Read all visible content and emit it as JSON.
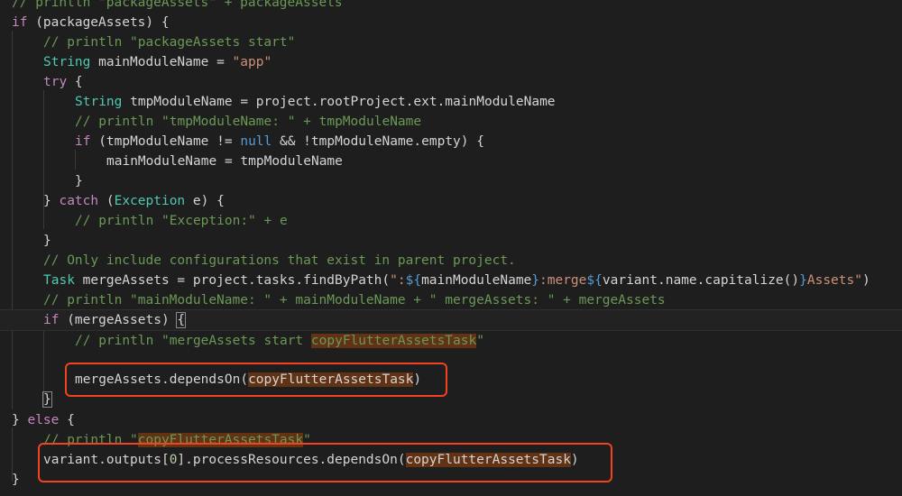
{
  "code_lines": [
    {
      "t": "// println \"packageAssets\" + packageAssets"
    },
    {
      "t": "if (packageAssets) {"
    },
    {
      "t": "// println \"packageAssets start\""
    },
    {
      "t": "String mainModuleName = \"app\""
    },
    {
      "t": "try {"
    },
    {
      "t": "String tmpModuleName = project.rootProject.ext.mainModuleName"
    },
    {
      "t": "// println \"tmpModuleName: \" + tmpModuleName"
    },
    {
      "t": "if (tmpModuleName != null && !tmpModuleName.empty) {"
    },
    {
      "t": "mainModuleName = tmpModuleName"
    },
    {
      "t": "}"
    },
    {
      "t": "} catch (Exception e) {"
    },
    {
      "t": "// println \"Exception:\" + e"
    },
    {
      "t": "}"
    },
    {
      "t": "// Only include configurations that exist in parent project."
    },
    {
      "t": "Task mergeAssets = project.tasks.findByPath(\":${mainModuleName}:merge${variant.name.capitalize()}Assets\")"
    },
    {
      "t": "// println \"mainModuleName: \" + mainModuleName + \" mergeAssets: \" + mergeAssets"
    },
    {
      "t": "if (mergeAssets) {"
    },
    {
      "t": "// println \"mergeAssets start copyFlutterAssetsTask\""
    },
    {
      "t": ""
    },
    {
      "t": "mergeAssets.dependsOn(copyFlutterAssetsTask)"
    },
    {
      "t": "}"
    },
    {
      "t": "} else {"
    },
    {
      "t": "// println \"copyFlutterAssetsTask\""
    },
    {
      "t": "variant.outputs[0].processResources.dependsOn(copyFlutterAssetsTask)"
    },
    {
      "t": "}"
    }
  ],
  "highlight": {
    "symbol": "copyFlutterAssetsTask",
    "color": "#613214"
  },
  "annotation_color": "#f2421f"
}
